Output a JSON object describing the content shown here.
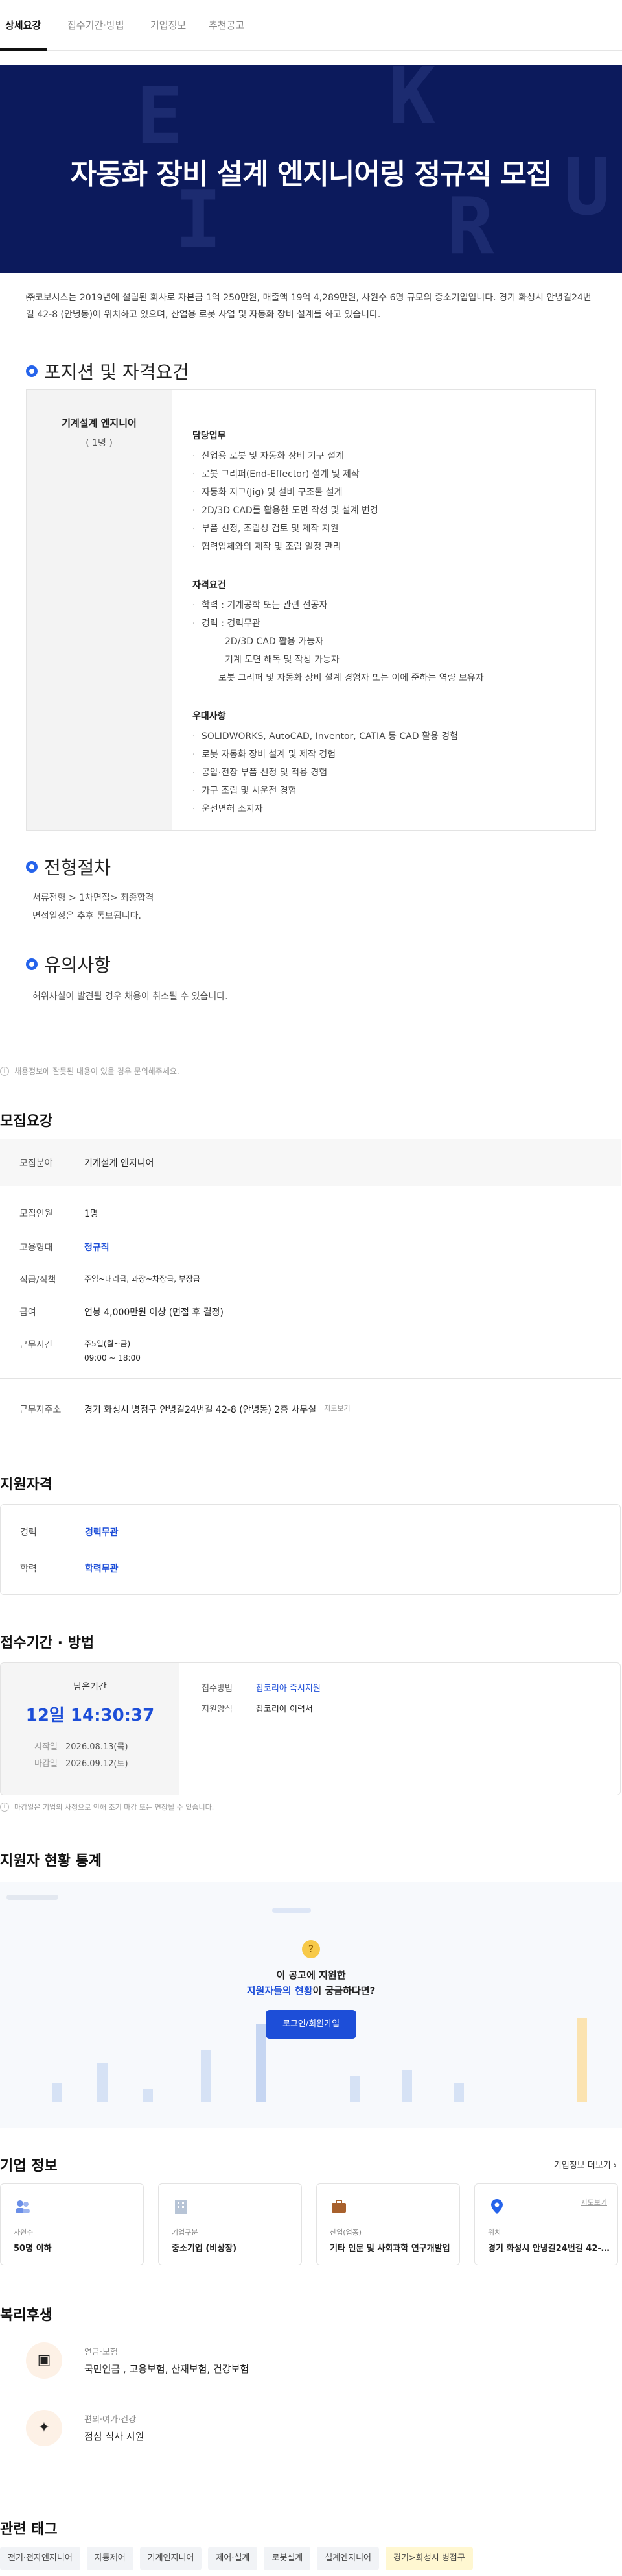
{
  "tabs": [
    {
      "label": "상세요강"
    },
    {
      "label": "접수기간·방법"
    },
    {
      "label": "기업정보"
    },
    {
      "label": "추천공고"
    }
  ],
  "hero": {
    "title": "자동화 장비 설계 엔지니어링 정규직 모집",
    "letters": [
      "E",
      "R",
      "K",
      "I",
      "U",
      "R"
    ]
  },
  "intro": "㈜코보시스는 2019년에 설립된 회사로 자본금 1억 250만원, 매출액 19억 4,289만원, 사원수 6명 규모의 중소기업입니다. 경기 화성시 안녕길24번길 42-8 (안녕동)에 위치하고 있으며, 산업용 로봇 사업 및 자동화 장비 설계를 하고 있습니다.",
  "position": {
    "heading": "포지션 및 자격요건",
    "title": "기계설계 엔지니어",
    "count": "( 1명 )",
    "groups": [
      {
        "title": "담당업무",
        "items": [
          "산업용 로봇 및 자동화 장비 기구 설계",
          "로봇 그리퍼(End-Effector) 설계 및 제작",
          "자동화 지그(Jig) 및 설비 구조물 설계",
          "2D/3D CAD를 활용한 도면 작성 및 설계 변경",
          "부품 선정, 조립성 검토 및 제작 지원",
          "협력업체와의 제작 및 조립 일정 관리"
        ]
      },
      {
        "title": "자격요건",
        "items": [
          "학력 : 기계공학 또는 관련 전공자",
          "경력 : 경력무관"
        ],
        "subs": [
          "2D/3D CAD 활용 가능자",
          "기계 도면 해독 및 작성 가능자",
          "로봇 그리퍼 및 자동화 장비 설계 경험자 또는 이에 준하는 역량 보유자"
        ]
      },
      {
        "title": "우대사항",
        "items": [
          "SOLIDWORKS, AutoCAD, Inventor, CATIA 등 CAD 활용 경험",
          "로봇 자동화 장비 설계 및 제작 경험",
          "공압·전장 부품 선정 및 적용 경험",
          "가구 조립 및 시운전 경험",
          "운전면허 소지자"
        ]
      }
    ]
  },
  "process": {
    "heading": "전형절차",
    "items": [
      "서류전형 > 1차면접> 최종합격",
      "면접일정은 추후 통보됩니다."
    ]
  },
  "notice": {
    "heading": "유의사항",
    "items": [
      "허위사실이 발견될 경우 채용이 취소될 수 있습니다."
    ]
  },
  "footnote1": "채용정보에 잘못된 내용이 있을 경우 문의해주세요.",
  "summary": {
    "heading": "모집요강",
    "rows": [
      {
        "k": "모집분야",
        "v": "기계설계 엔지니어"
      },
      {
        "k": "모집인원",
        "v": "1명"
      },
      {
        "k": "고용형태",
        "v": "정규직"
      },
      {
        "k": "직급/직책",
        "v": "주임~대리급, 과장~차장급, 부장급"
      },
      {
        "k": "급여",
        "v": "연봉 4,000만원 이상 (면접 후 결정)"
      },
      {
        "k": "근무시간",
        "v": "주5일(월~금)"
      },
      {
        "k": "",
        "v": "09:00 ~ 18:00"
      },
      {
        "k": "근무지주소",
        "v": "경기 화성시 병점구 안녕길24번길 42-8 (안녕동) 2층 사무실"
      }
    ],
    "map_link": "지도보기"
  },
  "qualification": {
    "heading": "지원자격",
    "rows": [
      {
        "k": "경력",
        "v": "경력무관"
      },
      {
        "k": "학력",
        "v": "학력무관"
      }
    ]
  },
  "apply": {
    "heading": "접수기간 · 방법",
    "remain_label": "남은기간",
    "remain": "12일 14:30:37",
    "start_label": "시작일",
    "start": "2026.08.13(목)",
    "end_label": "마감일",
    "end": "2026.09.12(토)",
    "method_label": "접수방법",
    "method": "잡코리아 즉시지원",
    "form_label": "지원양식",
    "form": "잡코리아 이력서",
    "note": "마감일은 기업의 사정으로 인해 조기 마감 또는 연장될 수 있습니다."
  },
  "stats": {
    "heading": "지원자 현황 통계",
    "q1": "이 공고에 지원한",
    "q2_hl": "지원자들의 현황",
    "q2": "이 궁금하다면?",
    "button": "로그인/회원가입"
  },
  "company": {
    "heading": "기업 정보",
    "more": "기업정보 더보기",
    "cards": [
      {
        "label": "사원수",
        "value": "50명 이하"
      },
      {
        "label": "기업구분",
        "value": "중소기업 (비상장)"
      },
      {
        "label": "산업(업종)",
        "value": "기타 인문 및 사회과학 연구개발업"
      },
      {
        "label": "위치",
        "value": "경기 화성시 안녕길24번길 42-8 (안녕동)",
        "link": "지도보기"
      }
    ]
  },
  "welfare": {
    "heading": "복리후생",
    "items": [
      {
        "t": "연금·보험",
        "d": "국민연금 , 고용보험, 산재보험, 건강보험"
      },
      {
        "t": "편의·여가·건강",
        "d": "점심 식사 지원"
      }
    ]
  },
  "tags_heading": "관련 태그",
  "tags": [
    "전기·전자엔지니어",
    "자동제어",
    "기계엔지니어",
    "제어·설계",
    "로봇설계",
    "설계엔지니어",
    "경기>화성시 병점구"
  ],
  "colors": {
    "accent": "#1d4ed8",
    "hero_bg": "#0c1a5c"
  }
}
